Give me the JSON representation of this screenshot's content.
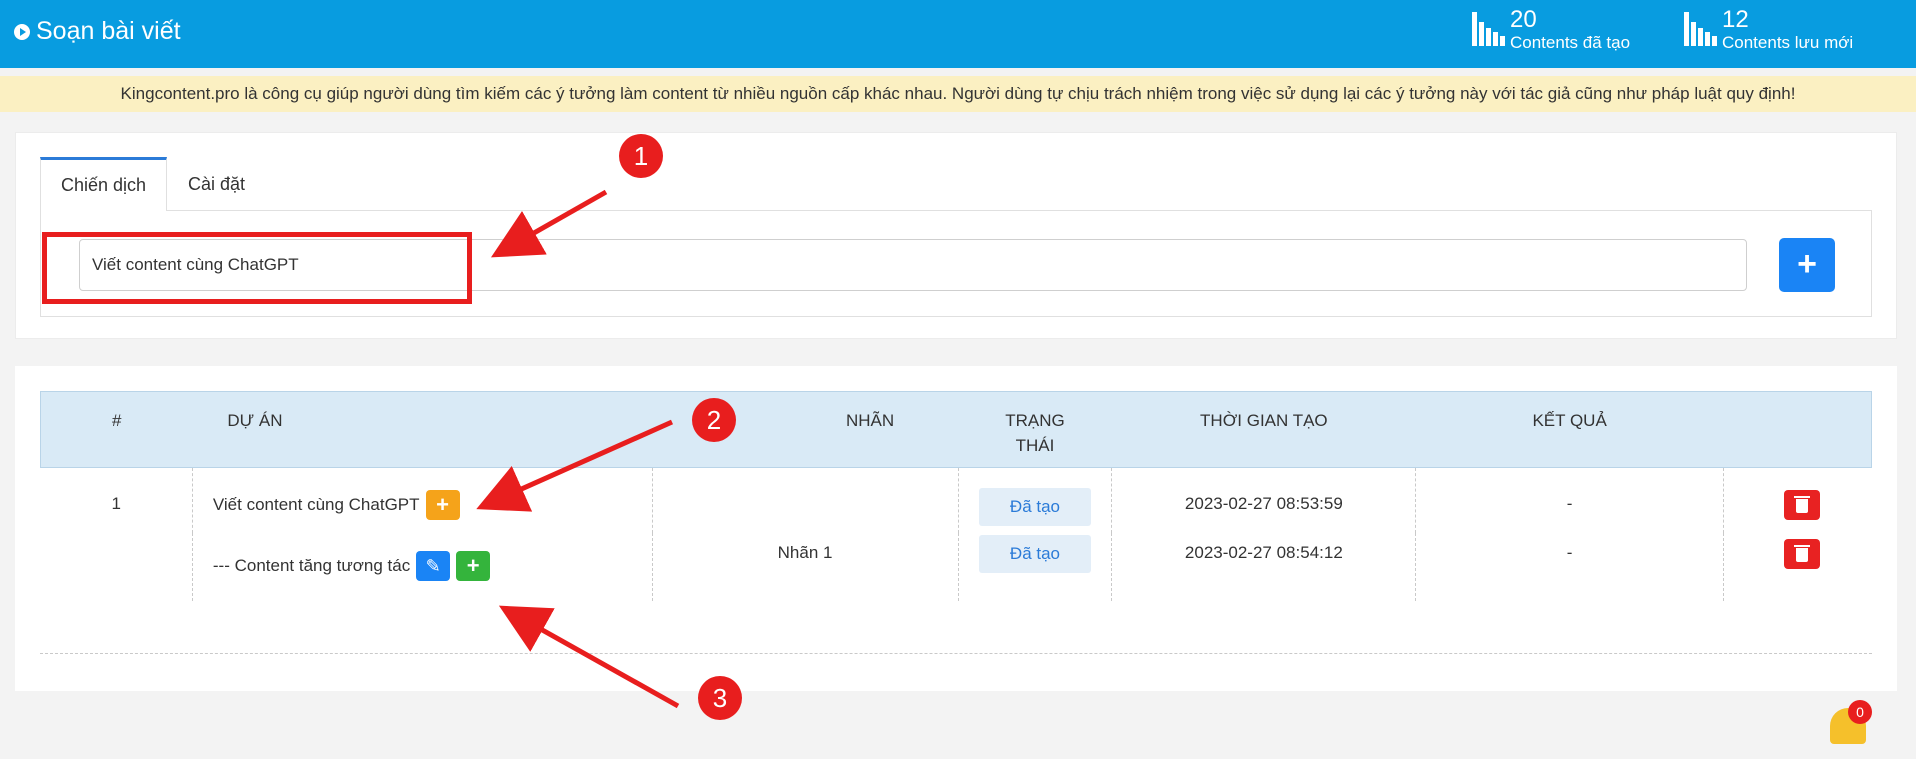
{
  "header": {
    "title": "Soạn bài viết",
    "stats": [
      {
        "value": "20",
        "label": "Contents đã tạo"
      },
      {
        "value": "12",
        "label": "Contents lưu mới"
      }
    ]
  },
  "notice": "Kingcontent.pro là công cụ giúp người dùng tìm kiếm các ý tưởng làm content từ nhiều nguồn cấp khác nhau. Người dùng tự chịu trách nhiệm trong việc sử dụng lại các ý tưởng này với tác giả cũng như pháp luật quy định!",
  "tabs": [
    {
      "label": "Chiến dịch"
    },
    {
      "label": "Cài đặt"
    }
  ],
  "campaign": {
    "input_value": "Viết content cùng ChatGPT",
    "add_label": "+"
  },
  "table": {
    "headers": [
      "#",
      "DỰ ÁN",
      "NHÃN",
      "TRẠNG THÁI",
      "THỜI GIAN TẠO",
      "KẾT QUẢ",
      ""
    ],
    "rows": [
      {
        "index": "1",
        "project": "Viết content cùng ChatGPT",
        "tag": "",
        "status": "Đã tạo",
        "created": "2023-02-27 08:53:59",
        "result": "-"
      },
      {
        "index": "",
        "project": "--- Content tăng tương tác",
        "tag": "Nhãn 1",
        "status": "Đã tạo",
        "created": "2023-02-27 08:54:12",
        "result": "-"
      }
    ]
  },
  "annotations": {
    "markers": [
      "1",
      "2",
      "3"
    ],
    "color": "#e81e1e"
  },
  "notifications": {
    "count": "0"
  },
  "colors": {
    "header": "#089ce0",
    "notice_bg": "#fbf0c2",
    "primary": "#1a84f5",
    "orange": "#f5a31a",
    "green": "#34b43c",
    "danger": "#e82222"
  }
}
